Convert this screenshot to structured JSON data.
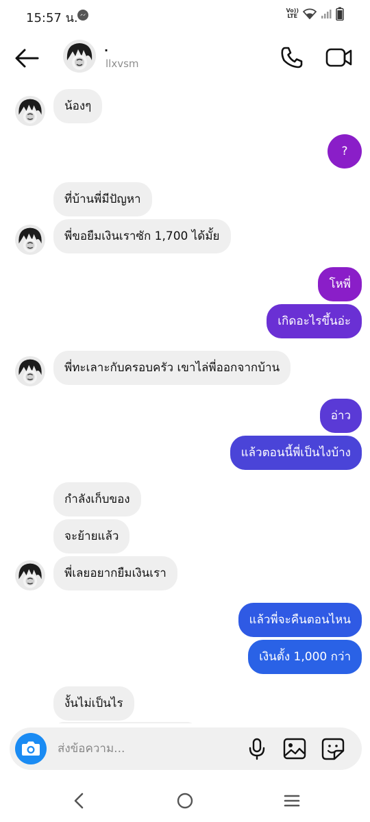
{
  "status_bar": {
    "time": "15:57 น.",
    "volte_top": "Vo))",
    "volte_bottom": "LTE"
  },
  "header": {
    "display_name": ".",
    "username": "llxvsm"
  },
  "messages": [
    {
      "from": "them",
      "text": "น้องๆ"
    },
    {
      "from": "me",
      "text": "?"
    },
    {
      "from": "them",
      "text": "ที่บ้านพี่มีปัญหา"
    },
    {
      "from": "them",
      "text": "พี่ขอยืมเงินเราซัก 1,700 ได้มั้ย"
    },
    {
      "from": "me",
      "text": "โหพี่"
    },
    {
      "from": "me",
      "text": "เกิดอะไรขึ้นอ่ะ"
    },
    {
      "from": "them",
      "text": "พี่ทะเลาะกับครอบครัว เขาไล่พี่ออกจากบ้าน"
    },
    {
      "from": "me",
      "text": "อ่าว"
    },
    {
      "from": "me",
      "text": "แล้วตอนนี้พี่เป็นไงบ้าง"
    },
    {
      "from": "them",
      "text": "กำลังเก็บของ"
    },
    {
      "from": "them",
      "text": "จะย้ายแล้ว"
    },
    {
      "from": "them",
      "text": "พี่เลยอยากยืมเงินเรา"
    },
    {
      "from": "me",
      "text": "แล้วพี่จะคืนตอนไหน"
    },
    {
      "from": "me",
      "text": "เงินตั้ง 1,000 กว่า"
    },
    {
      "from": "them",
      "text": "งั้นไม่เป็นไร"
    }
  ],
  "composer": {
    "placeholder": "ส่งข้อความ..."
  },
  "colors": {
    "bubble_purple": "#8a1ec8",
    "bubble_violet": "#6a30d4",
    "bubble_indigo": "#4a44d8",
    "bubble_blue": "#2a62e6",
    "bubble_incoming": "#efefef",
    "camera_button": "#1a8bf3"
  },
  "icons": {
    "back": "arrow-left-icon",
    "call": "phone-icon",
    "video": "video-camera-icon",
    "camera": "camera-icon",
    "mic": "microphone-icon",
    "gallery": "image-icon",
    "sticker": "sticker-icon"
  }
}
